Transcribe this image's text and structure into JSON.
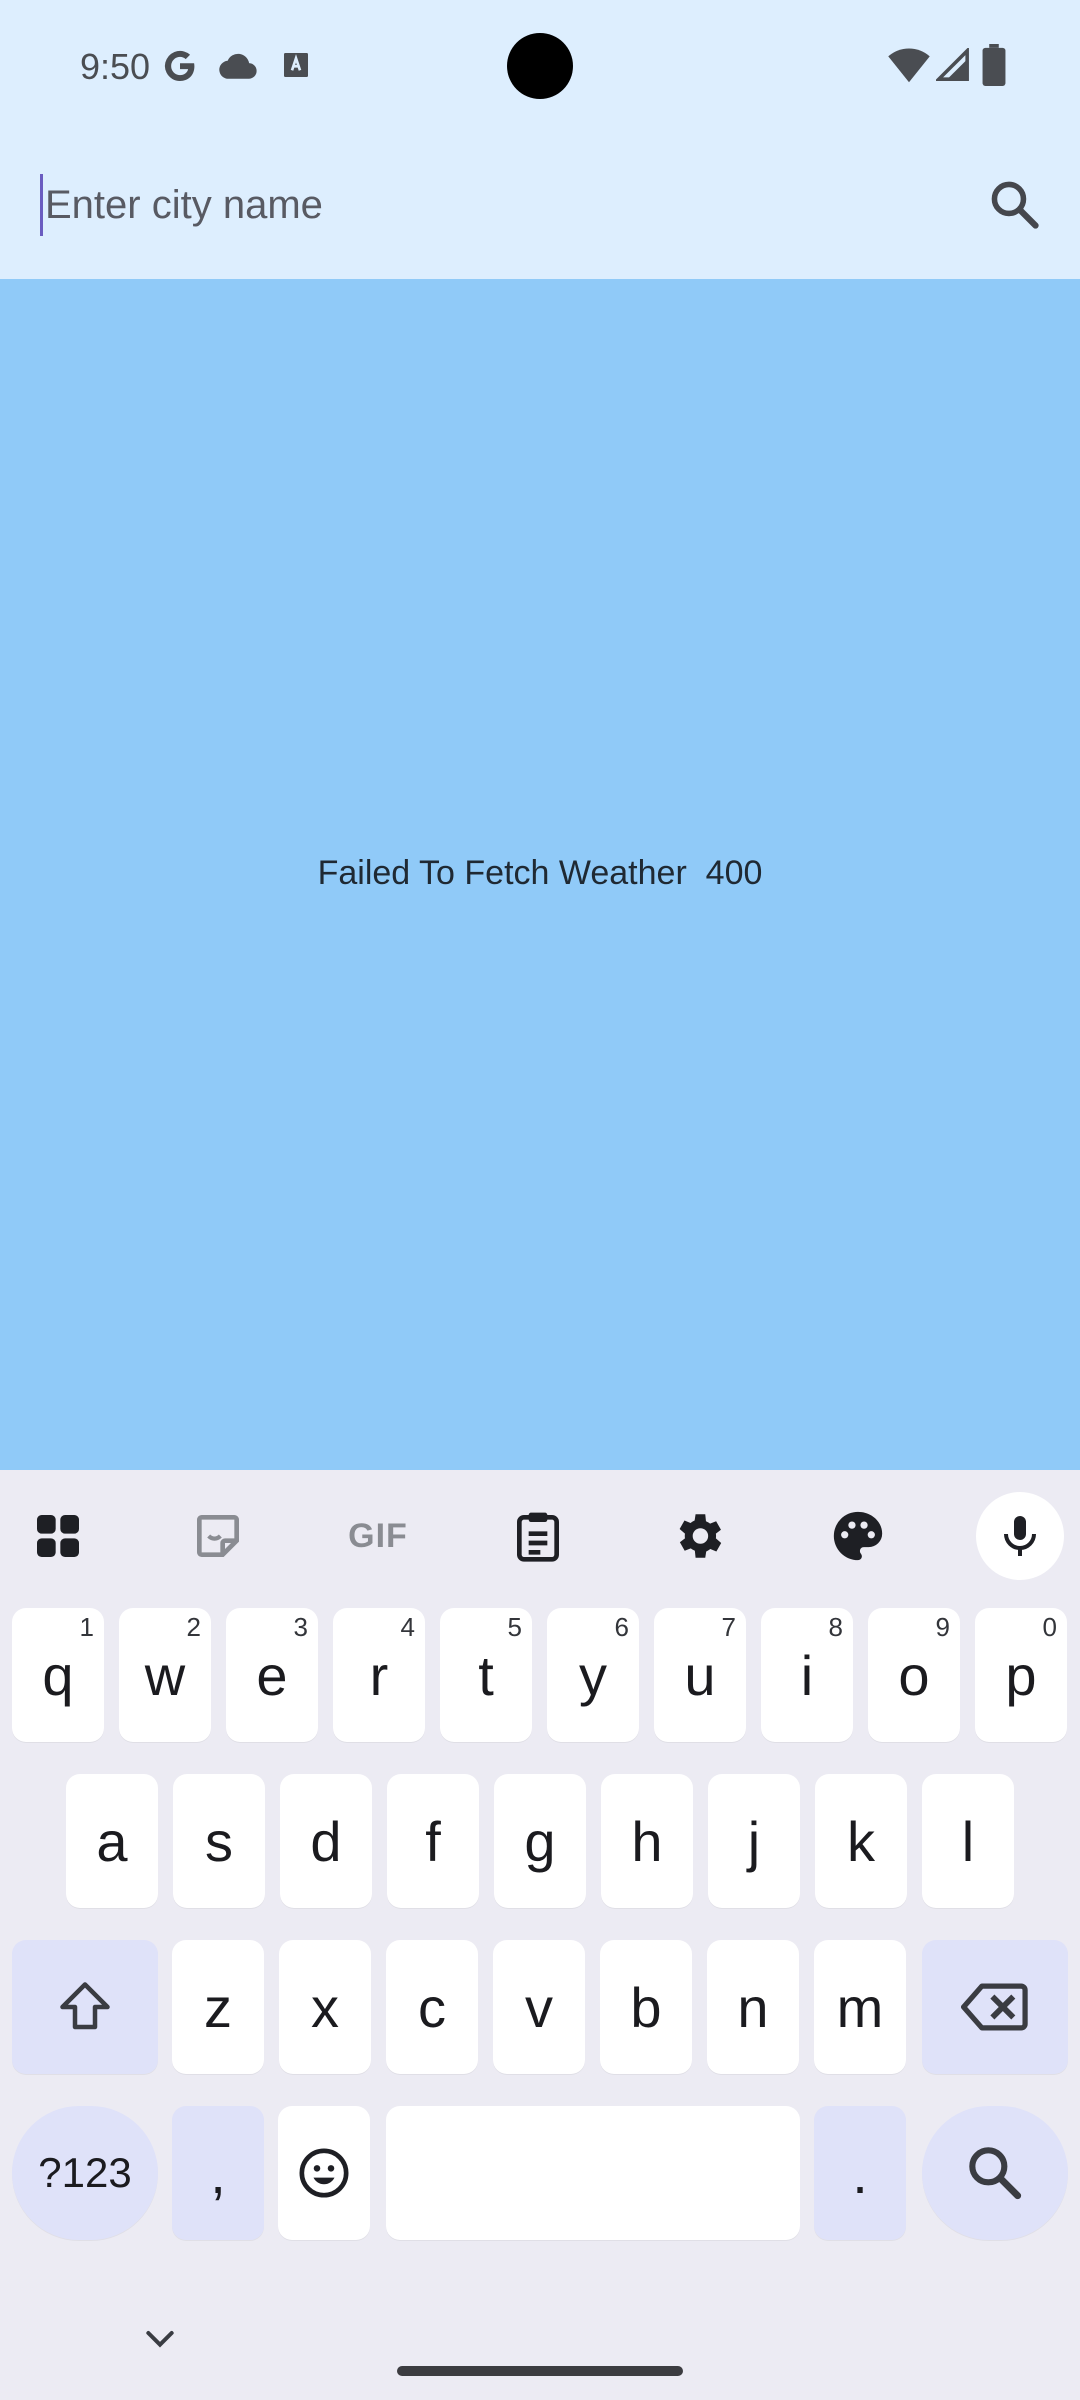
{
  "status_bar": {
    "time": "9:50",
    "icons": [
      "google-icon",
      "cloud-icon",
      "font-notification-icon",
      "wifi-icon",
      "signal-icon",
      "battery-icon"
    ]
  },
  "search": {
    "placeholder": "Enter city name",
    "value": "",
    "button_icon": "search-icon"
  },
  "main": {
    "error_message": "Failed To Fetch Weather  400",
    "background": "#90caf8"
  },
  "keyboard": {
    "toolbar": [
      "apps-grid-icon",
      "sticker-icon",
      "GIF",
      "clipboard-icon",
      "settings-icon",
      "palette-icon",
      "mic-icon"
    ],
    "gif_label": "GIF",
    "row1": [
      {
        "key": "q",
        "hint": "1"
      },
      {
        "key": "w",
        "hint": "2"
      },
      {
        "key": "e",
        "hint": "3"
      },
      {
        "key": "r",
        "hint": "4"
      },
      {
        "key": "t",
        "hint": "5"
      },
      {
        "key": "y",
        "hint": "6"
      },
      {
        "key": "u",
        "hint": "7"
      },
      {
        "key": "i",
        "hint": "8"
      },
      {
        "key": "o",
        "hint": "9"
      },
      {
        "key": "p",
        "hint": "0"
      }
    ],
    "row2": [
      "a",
      "s",
      "d",
      "f",
      "g",
      "h",
      "j",
      "k",
      "l"
    ],
    "row3": [
      "z",
      "x",
      "c",
      "v",
      "b",
      "n",
      "m"
    ],
    "symbols_label": "?123",
    "comma_label": ",",
    "period_label": ".",
    "space_label": ""
  },
  "colors": {
    "topbar": "#ddeefe",
    "keyboard_bg": "#ecebf3",
    "mod_key": "#dfe2f9",
    "caret": "#6a5cc0"
  }
}
